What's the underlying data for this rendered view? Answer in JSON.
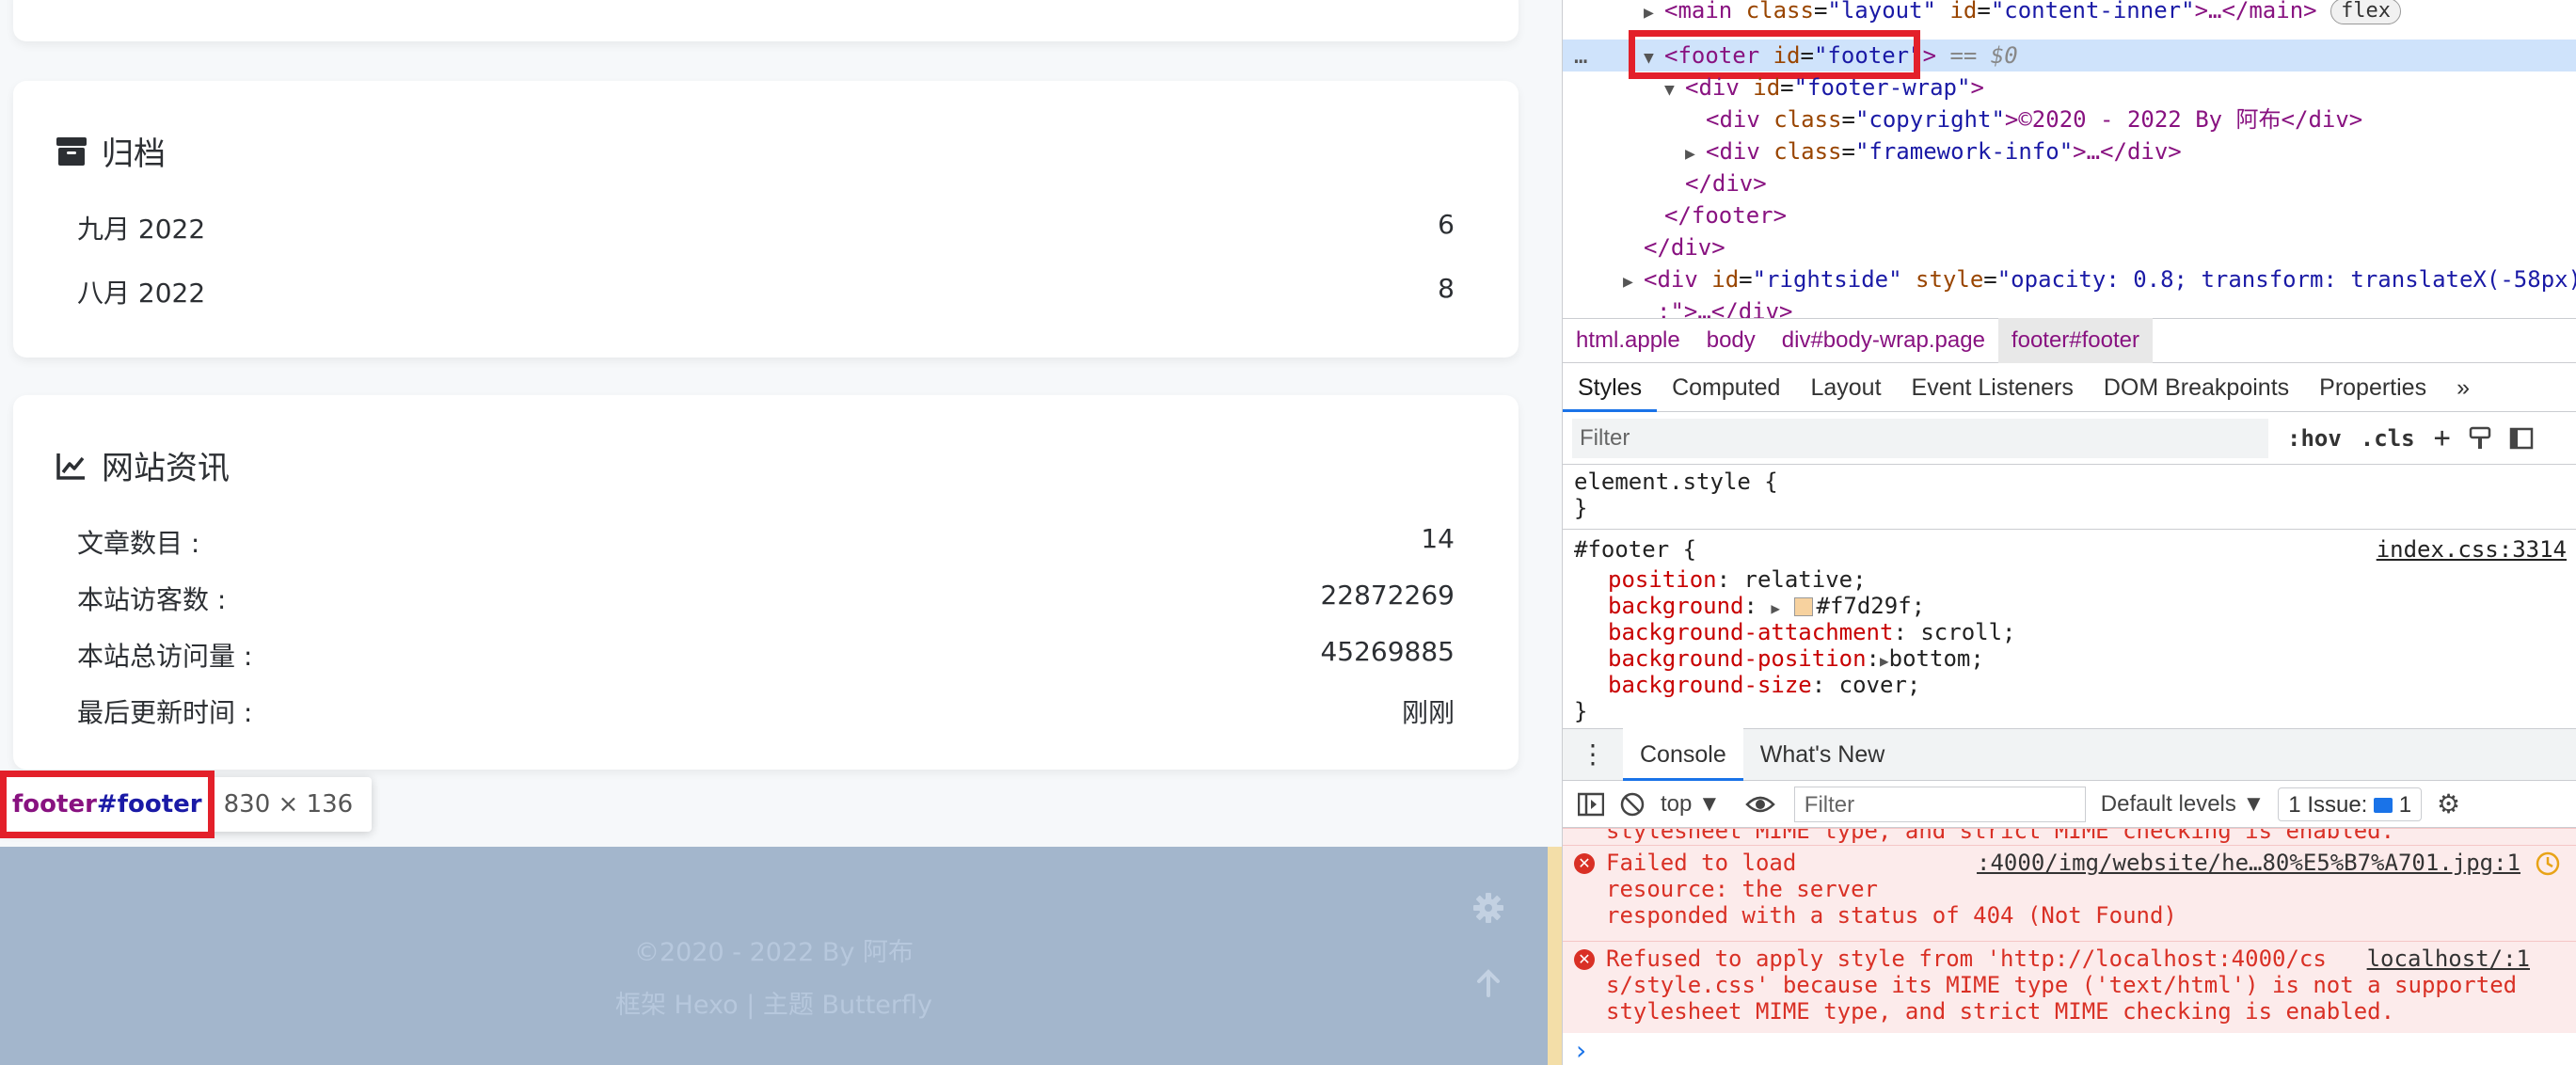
{
  "archive": {
    "title": "归档",
    "rows": [
      {
        "label": "九月 2022",
        "count": "6"
      },
      {
        "label": "八月 2022",
        "count": "8"
      }
    ]
  },
  "site_info": {
    "title": "网站资讯",
    "rows": [
      {
        "label": "文章数目 :",
        "value": "14"
      },
      {
        "label": "本站访客数 :",
        "value": "22872269"
      },
      {
        "label": "本站总访问量 :",
        "value": "45269885"
      },
      {
        "label": "最后更新时间 :",
        "value": "刚刚"
      }
    ]
  },
  "tooltip": {
    "tag": "footer",
    "id": "#footer",
    "dims": "830 × 136"
  },
  "footer": {
    "copyright": "©2020 - 2022 By 阿布",
    "framework": "框架 Hexo | 主题 Butterfly",
    "color": "#a3b6cc"
  },
  "elements": {
    "l1_tag": "<main",
    "l1_attr1": "class",
    "l1_val1": "\"layout\"",
    "l1_attr2": "id",
    "l1_val2": "\"content-inner\"",
    "l1_rest": ">…</main>",
    "l1_badge": "flex",
    "l2_tag": "<footer",
    "l2_attr": "id",
    "l2_val": "\"footer\"",
    "l2_close": ">",
    "l2_eq": "==",
    "l2_ref": "$0",
    "l3_tag": "<div",
    "l3_attr": "id",
    "l3_val": "\"footer-wrap\"",
    "l3_close": ">",
    "l4_tag": "<div",
    "l4_attr": "class",
    "l4_val": "\"copyright\"",
    "l4_text": ">©2020 - 2022 By 阿布</div>",
    "l5_tag": "<div",
    "l5_attr": "class",
    "l5_val": "\"framework-info\"",
    "l5_rest": ">…</div>",
    "l6": "</div>",
    "l7": "</footer>",
    "l8": "</div>",
    "l9_tag": "<div",
    "l9_attr1": "id",
    "l9_val1": "\"rightside\"",
    "l9_attr2": "style",
    "l9_val2": "\"opacity: 0.8; transform: translateX(-58px)",
    "l10": ";\">…</div>"
  },
  "breadcrumbs": [
    "html.apple",
    "body",
    "div#body-wrap.page",
    "footer#footer"
  ],
  "styles_tabs": [
    "Styles",
    "Computed",
    "Layout",
    "Event Listeners",
    "DOM Breakpoints",
    "Properties",
    "»"
  ],
  "styles_filter": {
    "placeholder": "Filter",
    "hov": ":hov",
    "cls": ".cls"
  },
  "element_style": {
    "open": "element.style {",
    "close": "}"
  },
  "footer_rule": {
    "selector": "#footer {",
    "source": "index.css:3314",
    "decls": [
      {
        "prop": "position",
        "value": "relative;"
      },
      {
        "prop": "background",
        "value": "#f7d29f;"
      },
      {
        "prop": "background-attachment",
        "value": "scroll;"
      },
      {
        "prop": "background-position",
        "value": "bottom;"
      },
      {
        "prop": "background-size",
        "value": "cover;"
      }
    ],
    "close": "}",
    "swatch": "#f7d29f"
  },
  "drawer_tabs": [
    "Console",
    "What's New"
  ],
  "console_bar": {
    "context": "top",
    "filter": "Filter",
    "levels": "Default levels",
    "issues": "1 Issue:",
    "issue_count": "1"
  },
  "console": {
    "truncated": "stylesheet MIME type, and strict MIME checking is enabled.",
    "err1_line1": "Failed to load",
    "err1_line2": "resource: the server",
    "err1_line3": "responded with a status of 404 (Not Found)",
    "err1_src": ":4000/img/website/he…80%E5%B7%A701.jpg:1",
    "err2_line1": "Refused to apply style from 'http://localhost:4000/cs",
    "err2_line2": "s/style.css' because its MIME type ('text/html') is not a supported",
    "err2_line3": "stylesheet MIME type, and strict MIME checking is enabled.",
    "err2_src": "localhost/:1",
    "prompt": "›"
  }
}
